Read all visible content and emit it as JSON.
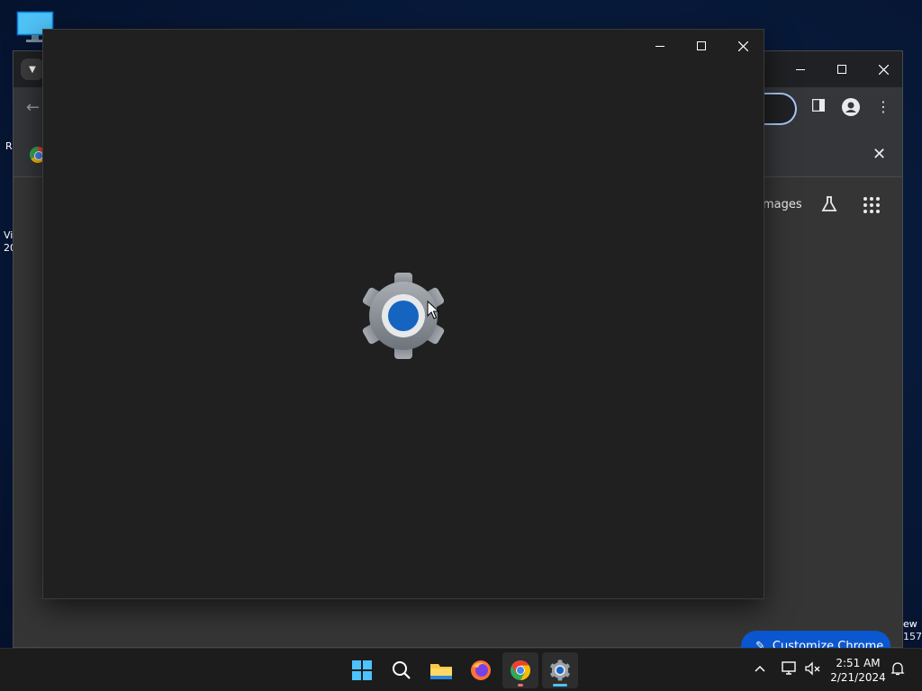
{
  "desktop": {
    "icons": [
      "monitor-icon"
    ],
    "left_text_1": "R",
    "left_text_2": "Vi",
    "left_text_3": "20"
  },
  "chrome": {
    "images_label": "mages",
    "customize_label": "Customize Chrome",
    "right_text_1": "ew",
    "right_text_2": "157"
  },
  "settings": {
    "state": "loading",
    "icon": "gear-icon"
  },
  "taskbar": {
    "apps": [
      "start-icon",
      "search-icon",
      "file-explorer-icon",
      "firefox-icon",
      "chrome-icon",
      "settings-icon"
    ],
    "time": "2:51 AM",
    "date": "2/21/2024"
  },
  "colors": {
    "accent": "#0b57d0",
    "gear_blue": "#1565c0",
    "window_bg": "#202020"
  }
}
